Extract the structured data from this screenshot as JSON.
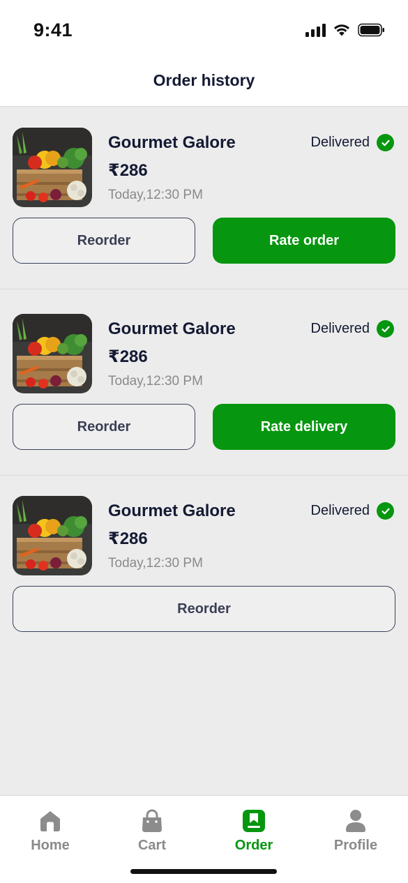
{
  "status_bar": {
    "time": "9:41"
  },
  "header": {
    "title": "Order history"
  },
  "orders": [
    {
      "store": "Gourmet Galore",
      "price": "₹286",
      "time": "Today,12:30 PM",
      "status": "Delivered",
      "primary_label": "Reorder",
      "secondary_label": "Rate order"
    },
    {
      "store": "Gourmet Galore",
      "price": "₹286",
      "time": "Today,12:30 PM",
      "status": "Delivered",
      "primary_label": "Reorder",
      "secondary_label": "Rate delivery"
    },
    {
      "store": "Gourmet Galore",
      "price": "₹286",
      "time": "Today,12:30 PM",
      "status": "Delivered",
      "primary_label": "Reorder"
    }
  ],
  "nav": {
    "items": [
      {
        "label": "Home",
        "icon": "home-icon"
      },
      {
        "label": "Cart",
        "icon": "cart-bag-icon"
      },
      {
        "label": "Order",
        "icon": "order-bookmark-icon"
      },
      {
        "label": "Profile",
        "icon": "profile-icon"
      }
    ],
    "active": "Order"
  },
  "colors": {
    "accent": "#06960f",
    "text_dark": "#141a33",
    "text_muted": "#8a8a8a",
    "background": "#ececec"
  }
}
